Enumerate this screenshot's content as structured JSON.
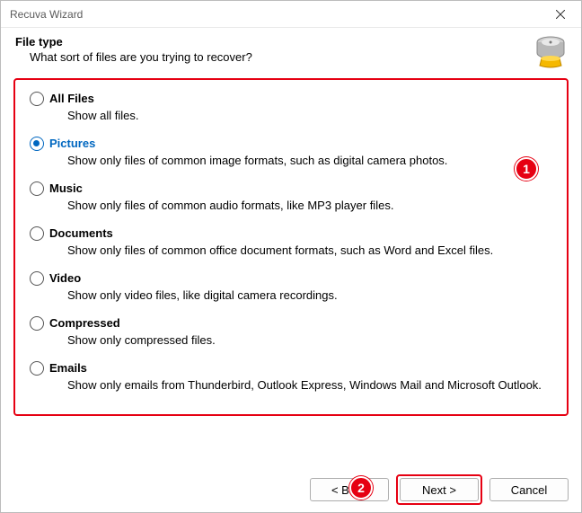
{
  "window": {
    "title": "Recuva Wizard"
  },
  "header": {
    "title": "File type",
    "subtitle": "What sort of files are you trying to recover?"
  },
  "options": {
    "all_files": {
      "label": "All Files",
      "desc": "Show all files."
    },
    "pictures": {
      "label": "Pictures",
      "desc": "Show only files of common image formats, such as digital camera photos."
    },
    "music": {
      "label": "Music",
      "desc": "Show only files of common audio formats, like MP3 player files."
    },
    "documents": {
      "label": "Documents",
      "desc": "Show only files of common office document formats, such as Word and Excel files."
    },
    "video": {
      "label": "Video",
      "desc": "Show only video files, like digital camera recordings."
    },
    "compressed": {
      "label": "Compressed",
      "desc": "Show only compressed files."
    },
    "emails": {
      "label": "Emails",
      "desc": "Show only emails from Thunderbird, Outlook Express, Windows Mail and Microsoft Outlook."
    }
  },
  "annotations": {
    "badge1": "1",
    "badge2": "2"
  },
  "buttons": {
    "back": "< Back",
    "next": "Next >",
    "cancel": "Cancel"
  }
}
